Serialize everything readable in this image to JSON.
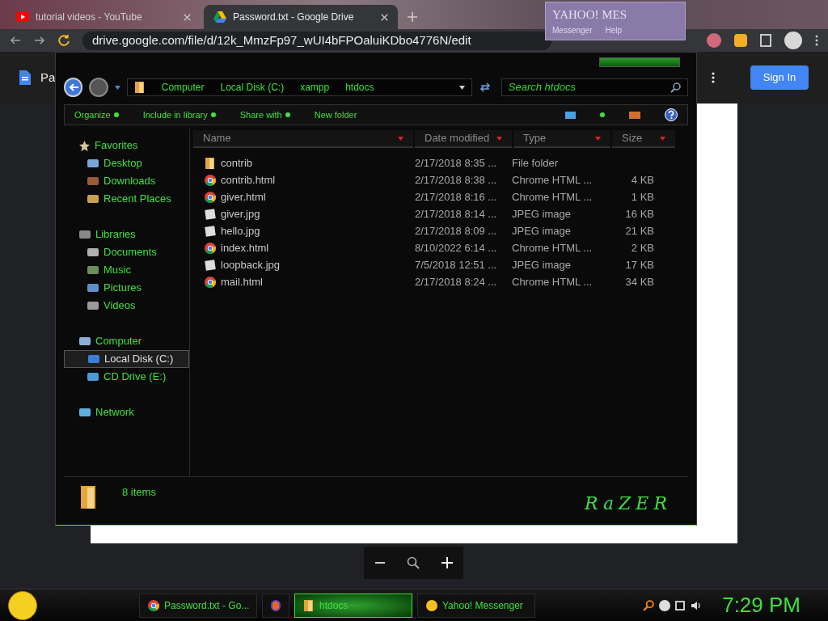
{
  "browser": {
    "tabs": [
      {
        "title": "tutorial videos - YouTube",
        "kind": "youtube",
        "selected": false
      },
      {
        "title": "Password.txt - Google Drive",
        "kind": "drive",
        "selected": true
      }
    ],
    "url": "drive.google.com/file/d/12k_MmzFp97_wUI4bFPOaluiKDbo4776N/edit",
    "doc_title": "Pa",
    "sign_in": "Sign In"
  },
  "yahoo_window": {
    "logo": "YAHOO! MES",
    "menu": [
      "Messenger",
      "Help"
    ]
  },
  "explorer": {
    "breadcrumb": [
      "Computer",
      "Local Disk (C:)",
      "xampp",
      "htdocs"
    ],
    "search_placeholder": "Search htdocs",
    "commands": [
      {
        "label": "Organize",
        "dropdown": true
      },
      {
        "label": "Include in library",
        "dropdown": true
      },
      {
        "label": "Share with",
        "dropdown": true
      },
      {
        "label": "New folder",
        "dropdown": false
      }
    ],
    "nav": [
      {
        "label": "Favorites",
        "kind": "star",
        "selected": false,
        "children": [
          {
            "label": "Desktop",
            "kind": "desktop",
            "selected": false
          },
          {
            "label": "Downloads",
            "kind": "download",
            "selected": false
          },
          {
            "label": "Recent Places",
            "kind": "recent",
            "selected": false
          }
        ]
      },
      {
        "label": "Libraries",
        "kind": "library",
        "selected": false,
        "children": [
          {
            "label": "Documents",
            "kind": "document",
            "selected": false
          },
          {
            "label": "Music",
            "kind": "music",
            "selected": false
          },
          {
            "label": "Pictures",
            "kind": "picture",
            "selected": false
          },
          {
            "label": "Videos",
            "kind": "video",
            "selected": false
          }
        ]
      },
      {
        "label": "Computer",
        "kind": "computer",
        "selected": false,
        "children": [
          {
            "label": "Local Disk (C:)",
            "kind": "disk",
            "selected": true
          },
          {
            "label": "CD Drive (E:)",
            "kind": "cd",
            "selected": false
          }
        ]
      },
      {
        "label": "Network",
        "kind": "network",
        "selected": false
      }
    ],
    "columns": [
      "Name",
      "Date modified",
      "Type",
      "Size"
    ],
    "rows": [
      {
        "kind": "folder",
        "name": "contrib",
        "date": "2/17/2018 8:35 ...",
        "type": "File folder",
        "size": ""
      },
      {
        "kind": "chrome",
        "name": "contrib.html",
        "date": "2/17/2018 8:38 ...",
        "type": "Chrome HTML ...",
        "size": "4 KB"
      },
      {
        "kind": "chrome",
        "name": "giver.html",
        "date": "2/17/2018 8:16 ...",
        "type": "Chrome HTML ...",
        "size": "1 KB"
      },
      {
        "kind": "image",
        "name": "giver.jpg",
        "date": "2/17/2018 8:14 ...",
        "type": "JPEG image",
        "size": "16 KB"
      },
      {
        "kind": "image",
        "name": "hello.jpg",
        "date": "2/17/2018 8:09 ...",
        "type": "JPEG image",
        "size": "21 KB"
      },
      {
        "kind": "chrome",
        "name": "index.html",
        "date": "8/10/2022 6:14 ...",
        "type": "Chrome HTML ...",
        "size": "2 KB"
      },
      {
        "kind": "image",
        "name": "loopback.jpg",
        "date": "7/5/2018 12:51 ...",
        "type": "JPEG image",
        "size": "17 KB"
      },
      {
        "kind": "chrome",
        "name": "mail.html",
        "date": "2/17/2018 8:24 ...",
        "type": "Chrome HTML ...",
        "size": "34 KB"
      }
    ],
    "status": "8 items",
    "brand": "RaZER"
  },
  "taskbar": {
    "items": [
      {
        "kind": "chrome",
        "label": "Password.txt - Go...",
        "selected": false
      },
      {
        "kind": "firefox",
        "selected": false
      },
      {
        "kind": "folder",
        "label": "htdocs",
        "selected": true
      },
      {
        "kind": "yahoo",
        "label": "Yahoo! Messenger",
        "selected": false
      }
    ],
    "clock": "7:29 PM"
  }
}
